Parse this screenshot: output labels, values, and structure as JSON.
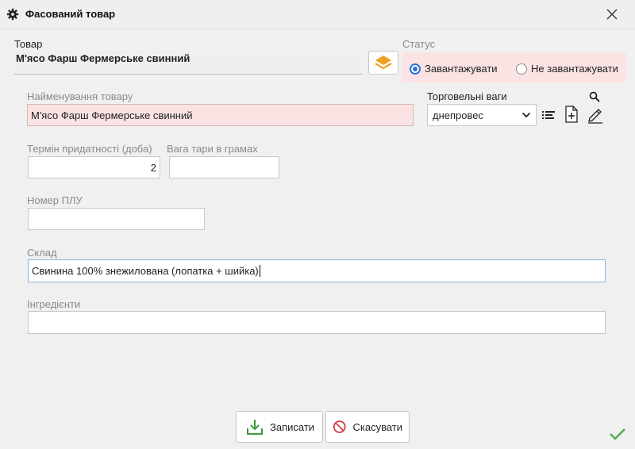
{
  "window": {
    "title": "Фасований товар",
    "icons": {
      "title": "gear-icon",
      "close": "close-icon"
    }
  },
  "product": {
    "label": "Товар",
    "value": "М'ясо Фарш Фермерське свинний",
    "icon": "layers-icon"
  },
  "status": {
    "label": "Статус",
    "options": [
      {
        "label": "Завантажувати",
        "selected": true
      },
      {
        "label": "Не завантажувати",
        "selected": false
      }
    ]
  },
  "name": {
    "label": "Найменування товару",
    "value": "М'ясо Фарш Фермерське свинний"
  },
  "scales": {
    "label": "Торговельні ваги",
    "value": "днепровес",
    "icons": [
      "search-icon",
      "chevron-down-icon",
      "list-icon",
      "add-file-icon",
      "edit-icon"
    ]
  },
  "shelf_life": {
    "label": "Термін придатності (доба)",
    "value": "2"
  },
  "tare_weight": {
    "label": "Вага тари в грамах",
    "value": ""
  },
  "plu": {
    "label": "Номер ПЛУ",
    "value": ""
  },
  "composition": {
    "label": "Склад",
    "value": "Свинина 100% знежилована (лопатка + шийка)"
  },
  "ingredients": {
    "label": "Інгредієнти",
    "value": ""
  },
  "buttons": {
    "save": "Записати",
    "cancel": "Скасувати"
  },
  "colors": {
    "required_bg": "#fbe3e3",
    "accent_blue": "#2a72d8",
    "save_green": "#3a9a3a",
    "cancel_red": "#d83a3a",
    "layers_orange": "#f0a020",
    "ok_green": "#4caf50"
  }
}
